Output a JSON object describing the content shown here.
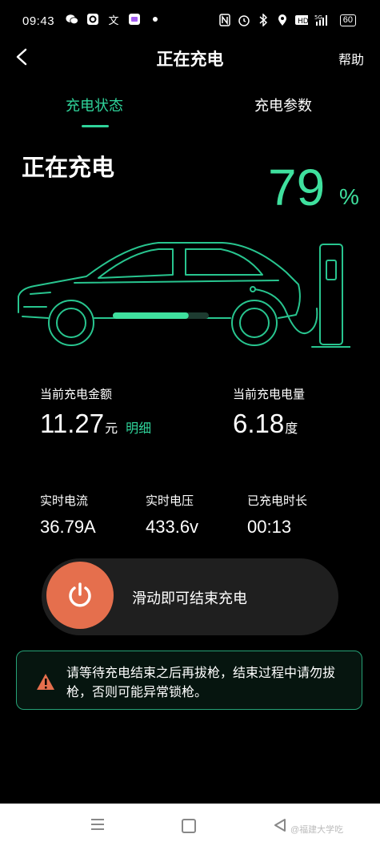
{
  "statusbar": {
    "time": "09:43",
    "left_icons": [
      "wechat-icon",
      "app-icon",
      "translate-icon",
      "app-icon",
      "dot-icon"
    ],
    "right_icons": [
      "nfc-icon",
      "alarm-icon",
      "bluetooth-icon",
      "location-icon",
      "hd-icon",
      "signal-icon"
    ],
    "network": "5G",
    "battery": "60"
  },
  "header": {
    "back_icon": "back-arrow-icon",
    "title": "正在充电",
    "help": "帮助"
  },
  "tabs": [
    {
      "label": "充电状态",
      "active": true
    },
    {
      "label": "充电参数",
      "active": false
    }
  ],
  "charging": {
    "status": "正在充电",
    "percent": "79",
    "percent_sign": "%",
    "progress": 0.79
  },
  "stats": {
    "amount": {
      "label": "当前充电金额",
      "value": "11.27",
      "unit": "元",
      "detail": "明细"
    },
    "energy": {
      "label": "当前充电电量",
      "value": "6.18",
      "unit": "度"
    },
    "current": {
      "label": "实时电流",
      "value": "36.79A"
    },
    "voltage": {
      "label": "实时电压",
      "value": "433.6v"
    },
    "duration": {
      "label": "已充电时长",
      "value": "00:13"
    }
  },
  "slider": {
    "text": "滑动即可结束充电",
    "icon": "power-icon"
  },
  "warning": {
    "icon": "warning-icon",
    "text": "请等待充电结束之后再拔枪，结束过程中请勿拔枪，否则可能异常锁枪。"
  },
  "colors": {
    "accent": "#2fd39a",
    "power": "#e56f4d",
    "background": "#000000"
  },
  "navbar": {
    "watermark": "@福建大学吃"
  }
}
